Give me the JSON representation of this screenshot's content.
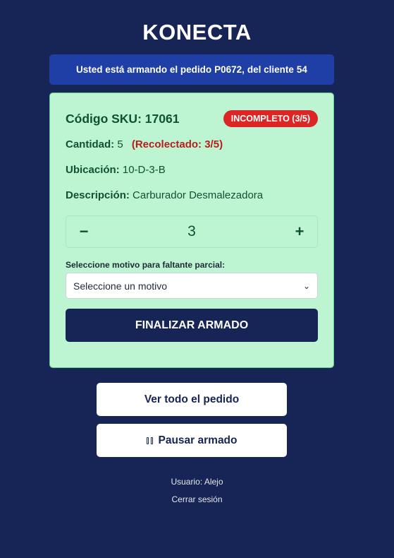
{
  "app": {
    "title": "KONECTA"
  },
  "banner": {
    "prefix": "Usted está armando el pedido",
    "order_id": "P0672,",
    "middle": "del cliente",
    "client_id": "54"
  },
  "item": {
    "sku_label": "Código SKU:",
    "sku_value": "17061",
    "status": "INCOMPLETO (3/5)",
    "quantity_label": "Cantidad:",
    "quantity_value": "5",
    "collected_text": "(Recolectado: 3/5)",
    "location_label": "Ubicación:",
    "location_value": "10-D-3-B",
    "description_label": "Descripción:",
    "description_value": "Carburador Desmalezadora"
  },
  "stepper": {
    "minus": "−",
    "value": "3",
    "plus": "+"
  },
  "motivo": {
    "label": "Seleccione motivo para faltante parcial:",
    "selected": "Seleccione un motivo"
  },
  "actions": {
    "finalize": "FINALIZAR ARMADO",
    "view_order": "Ver todo el pedido",
    "pause": "Pausar armado"
  },
  "footer": {
    "user": "Usuario: Alejo",
    "logout": "Cerrar sesión"
  },
  "colors": {
    "background": "#172456",
    "banner": "#1f3fa6",
    "card": "#bdf5d3",
    "status_badge": "#dc2626",
    "collected": "#b91c1c"
  }
}
